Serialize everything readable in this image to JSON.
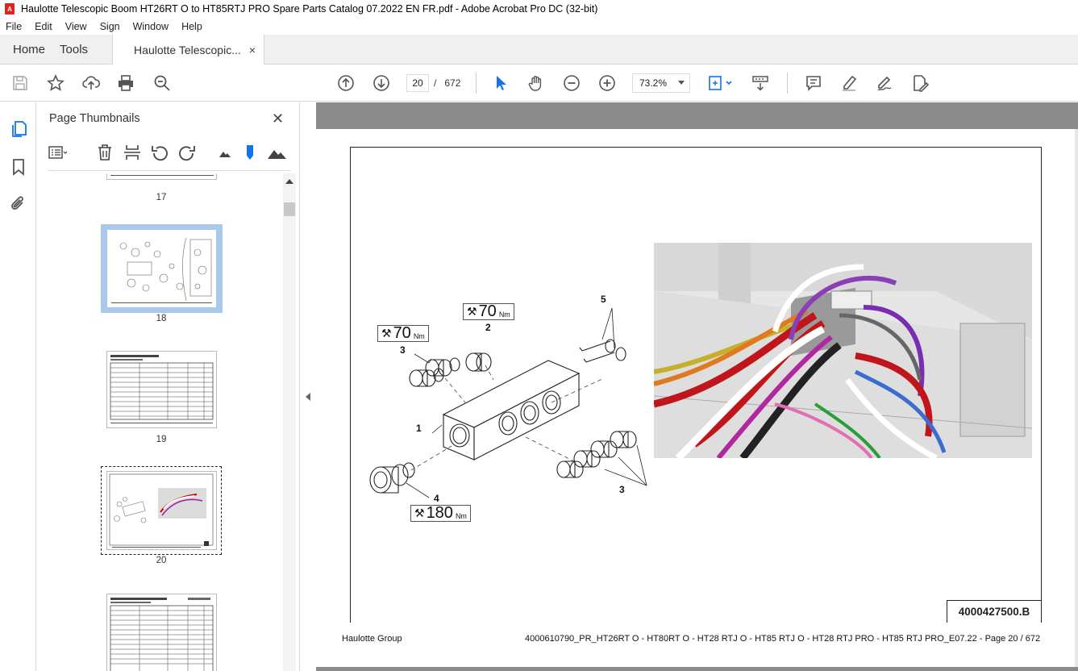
{
  "window": {
    "title": "Haulotte Telescopic Boom HT26RT O to HT85RTJ PRO Spare Parts Catalog 07.2022 EN FR.pdf - Adobe Acrobat Pro DC (32-bit)"
  },
  "menu": [
    "File",
    "Edit",
    "View",
    "Sign",
    "Window",
    "Help"
  ],
  "tabs": {
    "home": "Home",
    "tools": "Tools",
    "document": "Haulotte Telescopic...",
    "close_glyph": "×"
  },
  "toolbar": {
    "current_page": "20",
    "page_sep": "/",
    "page_total": "672",
    "zoom": "73.2%",
    "icons": [
      "save-icon",
      "star-icon",
      "upload-icon",
      "print-icon",
      "search-zoom-icon",
      "arrow-up-icon",
      "arrow-down-icon",
      "pointer-icon",
      "hand-icon",
      "zoom-out-icon",
      "zoom-in-icon",
      "fit-page-icon",
      "scroll-mode-icon",
      "comment-icon",
      "highlight-icon",
      "sign-icon",
      "edit-pdf-icon"
    ]
  },
  "panel": {
    "title": "Page Thumbnails",
    "close_glyph": "✕",
    "thumbnails": [
      {
        "label": "17"
      },
      {
        "label": "18",
        "selected": true
      },
      {
        "label": "19"
      },
      {
        "label": "20",
        "current": true
      },
      {
        "label": ""
      }
    ]
  },
  "document": {
    "drawing_number": "4000427500.B",
    "footer_left": "Haulotte Group",
    "footer_right": "4000610790_PR_HT26RT O - HT80RT O - HT28 RTJ O - HT85 RTJ O - HT28 RTJ PRO - HT85 RTJ PRO_E07.22 - Page 20 / 672",
    "torques": [
      {
        "value": "70",
        "unit": "Nm"
      },
      {
        "value": "70",
        "unit": "Nm"
      },
      {
        "value": "180",
        "unit": "Nm"
      }
    ],
    "callouts": [
      "1",
      "2",
      "3",
      "3",
      "4",
      "5"
    ]
  },
  "colors": {
    "accent_blue": "#1473e6",
    "viewer_gray": "#8b8b8b",
    "selected_thumb": "#a9c8ea"
  }
}
